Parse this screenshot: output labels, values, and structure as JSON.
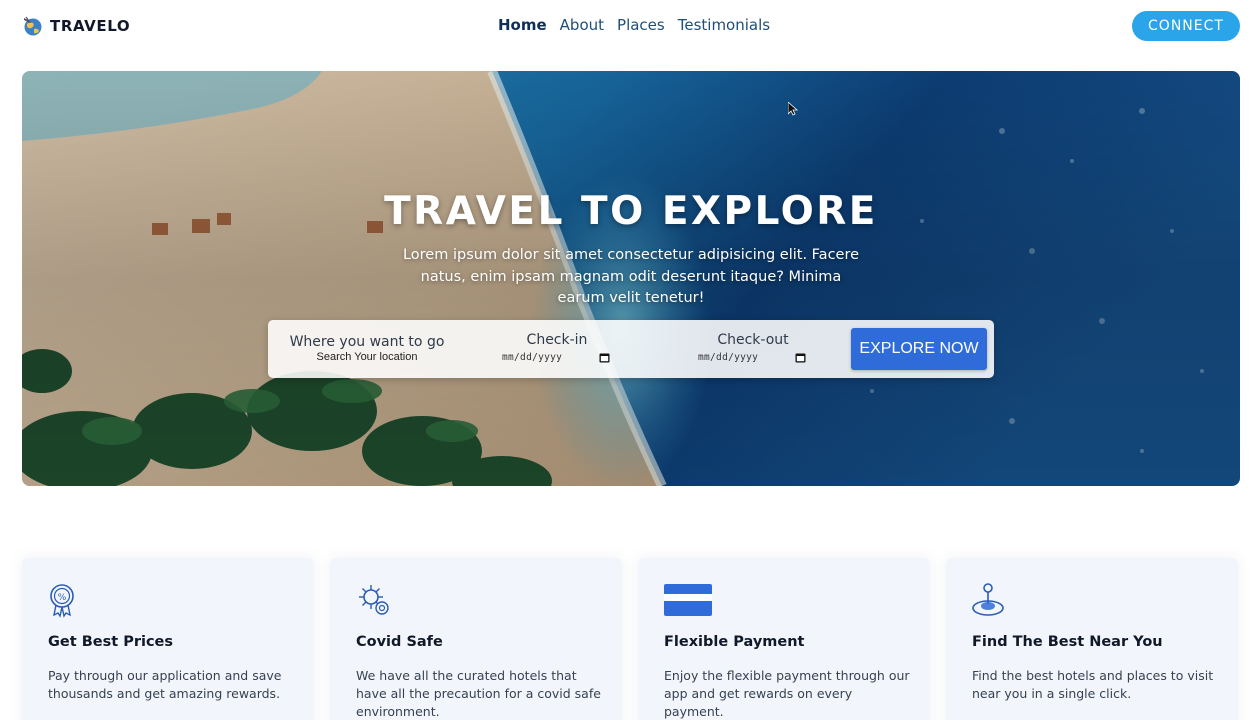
{
  "brand": {
    "name": "TRAVELO",
    "logo_icon": "globe-plane-icon"
  },
  "nav": {
    "links": [
      {
        "label": "Home",
        "active": true
      },
      {
        "label": "About",
        "active": false
      },
      {
        "label": "Places",
        "active": false
      },
      {
        "label": "Testimonials",
        "active": false
      }
    ],
    "connect_label": "CONNECT"
  },
  "hero": {
    "title": "TRAVEL TO EXPLORE",
    "description": "Lorem ipsum dolor sit amet consectetur adipisicing elit. Facere natus, enim ipsam magnam odit deserunt itaque? Minima earum velit tenetur!",
    "search": {
      "where_label": "Where you want to go",
      "where_placeholder": "Search Your location",
      "checkin_label": "Check-in",
      "checkin_placeholder": "mm/dd/yyyy",
      "checkout_label": "Check-out",
      "checkout_placeholder": "mm/dd/yyyy",
      "button_label": "EXPLORE NOW"
    }
  },
  "features": [
    {
      "icon": "discount-badge-icon",
      "title": "Get Best Prices",
      "text": "Pay through our application and save thousands and get amazing rewards."
    },
    {
      "icon": "virus-shield-icon",
      "title": "Covid Safe",
      "text": "We have all the curated hotels that have all the precaution for a covid safe environment."
    },
    {
      "icon": "credit-card-icon",
      "title": "Flexible Payment",
      "text": "Enjoy the flexible payment through our app and get rewards on every payment."
    },
    {
      "icon": "location-pin-icon",
      "title": "Find The Best Near You",
      "text": "Find the best hotels and places to visit near you in a single click."
    }
  ],
  "colors": {
    "accent": "#2f6bd9",
    "connect": "#2aa5ea",
    "nav_text": "#1e4e7a",
    "card_bg": "#f2f6fc",
    "icon_blue": "#2a5cb3"
  }
}
